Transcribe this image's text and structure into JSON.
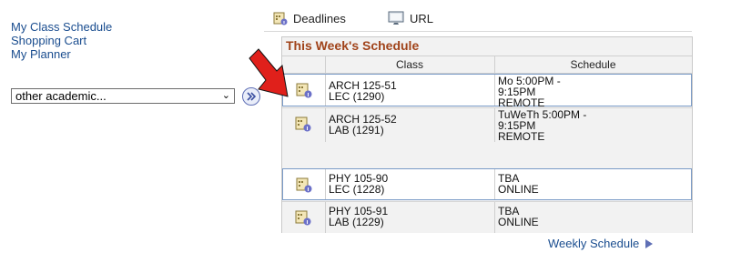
{
  "links": [
    "My Class Schedule",
    "Shopping Cart",
    "My Planner"
  ],
  "select": {
    "value": "other academic..."
  },
  "top_nav": {
    "deadlines": "Deadlines",
    "url": "URL"
  },
  "schedule": {
    "title": "This Week's Schedule",
    "headers": {
      "class": "Class",
      "schedule": "Schedule"
    },
    "rows": [
      {
        "class_line1": "ARCH 125-51",
        "class_line2": "LEC (1290)",
        "sched": [
          "Mo 5:00PM -",
          "9:15PM",
          "REMOTE"
        ]
      },
      {
        "class_line1": "ARCH 125-52",
        "class_line2": "LAB (1291)",
        "sched": [
          "TuWeTh 5:00PM -",
          "9:15PM",
          "REMOTE"
        ]
      },
      {
        "class_line1": "PHY 105-90",
        "class_line2": "LEC (1228)",
        "sched": [
          "TBA",
          "ONLINE",
          ""
        ]
      },
      {
        "class_line1": "PHY 105-91",
        "class_line2": "LAB (1229)",
        "sched": [
          "TBA",
          "ONLINE",
          ""
        ]
      }
    ]
  },
  "weekly_link": "Weekly Schedule",
  "colors": {
    "link": "#1a4d8f",
    "title": "#a0431a",
    "arrow": "#e0201b"
  }
}
